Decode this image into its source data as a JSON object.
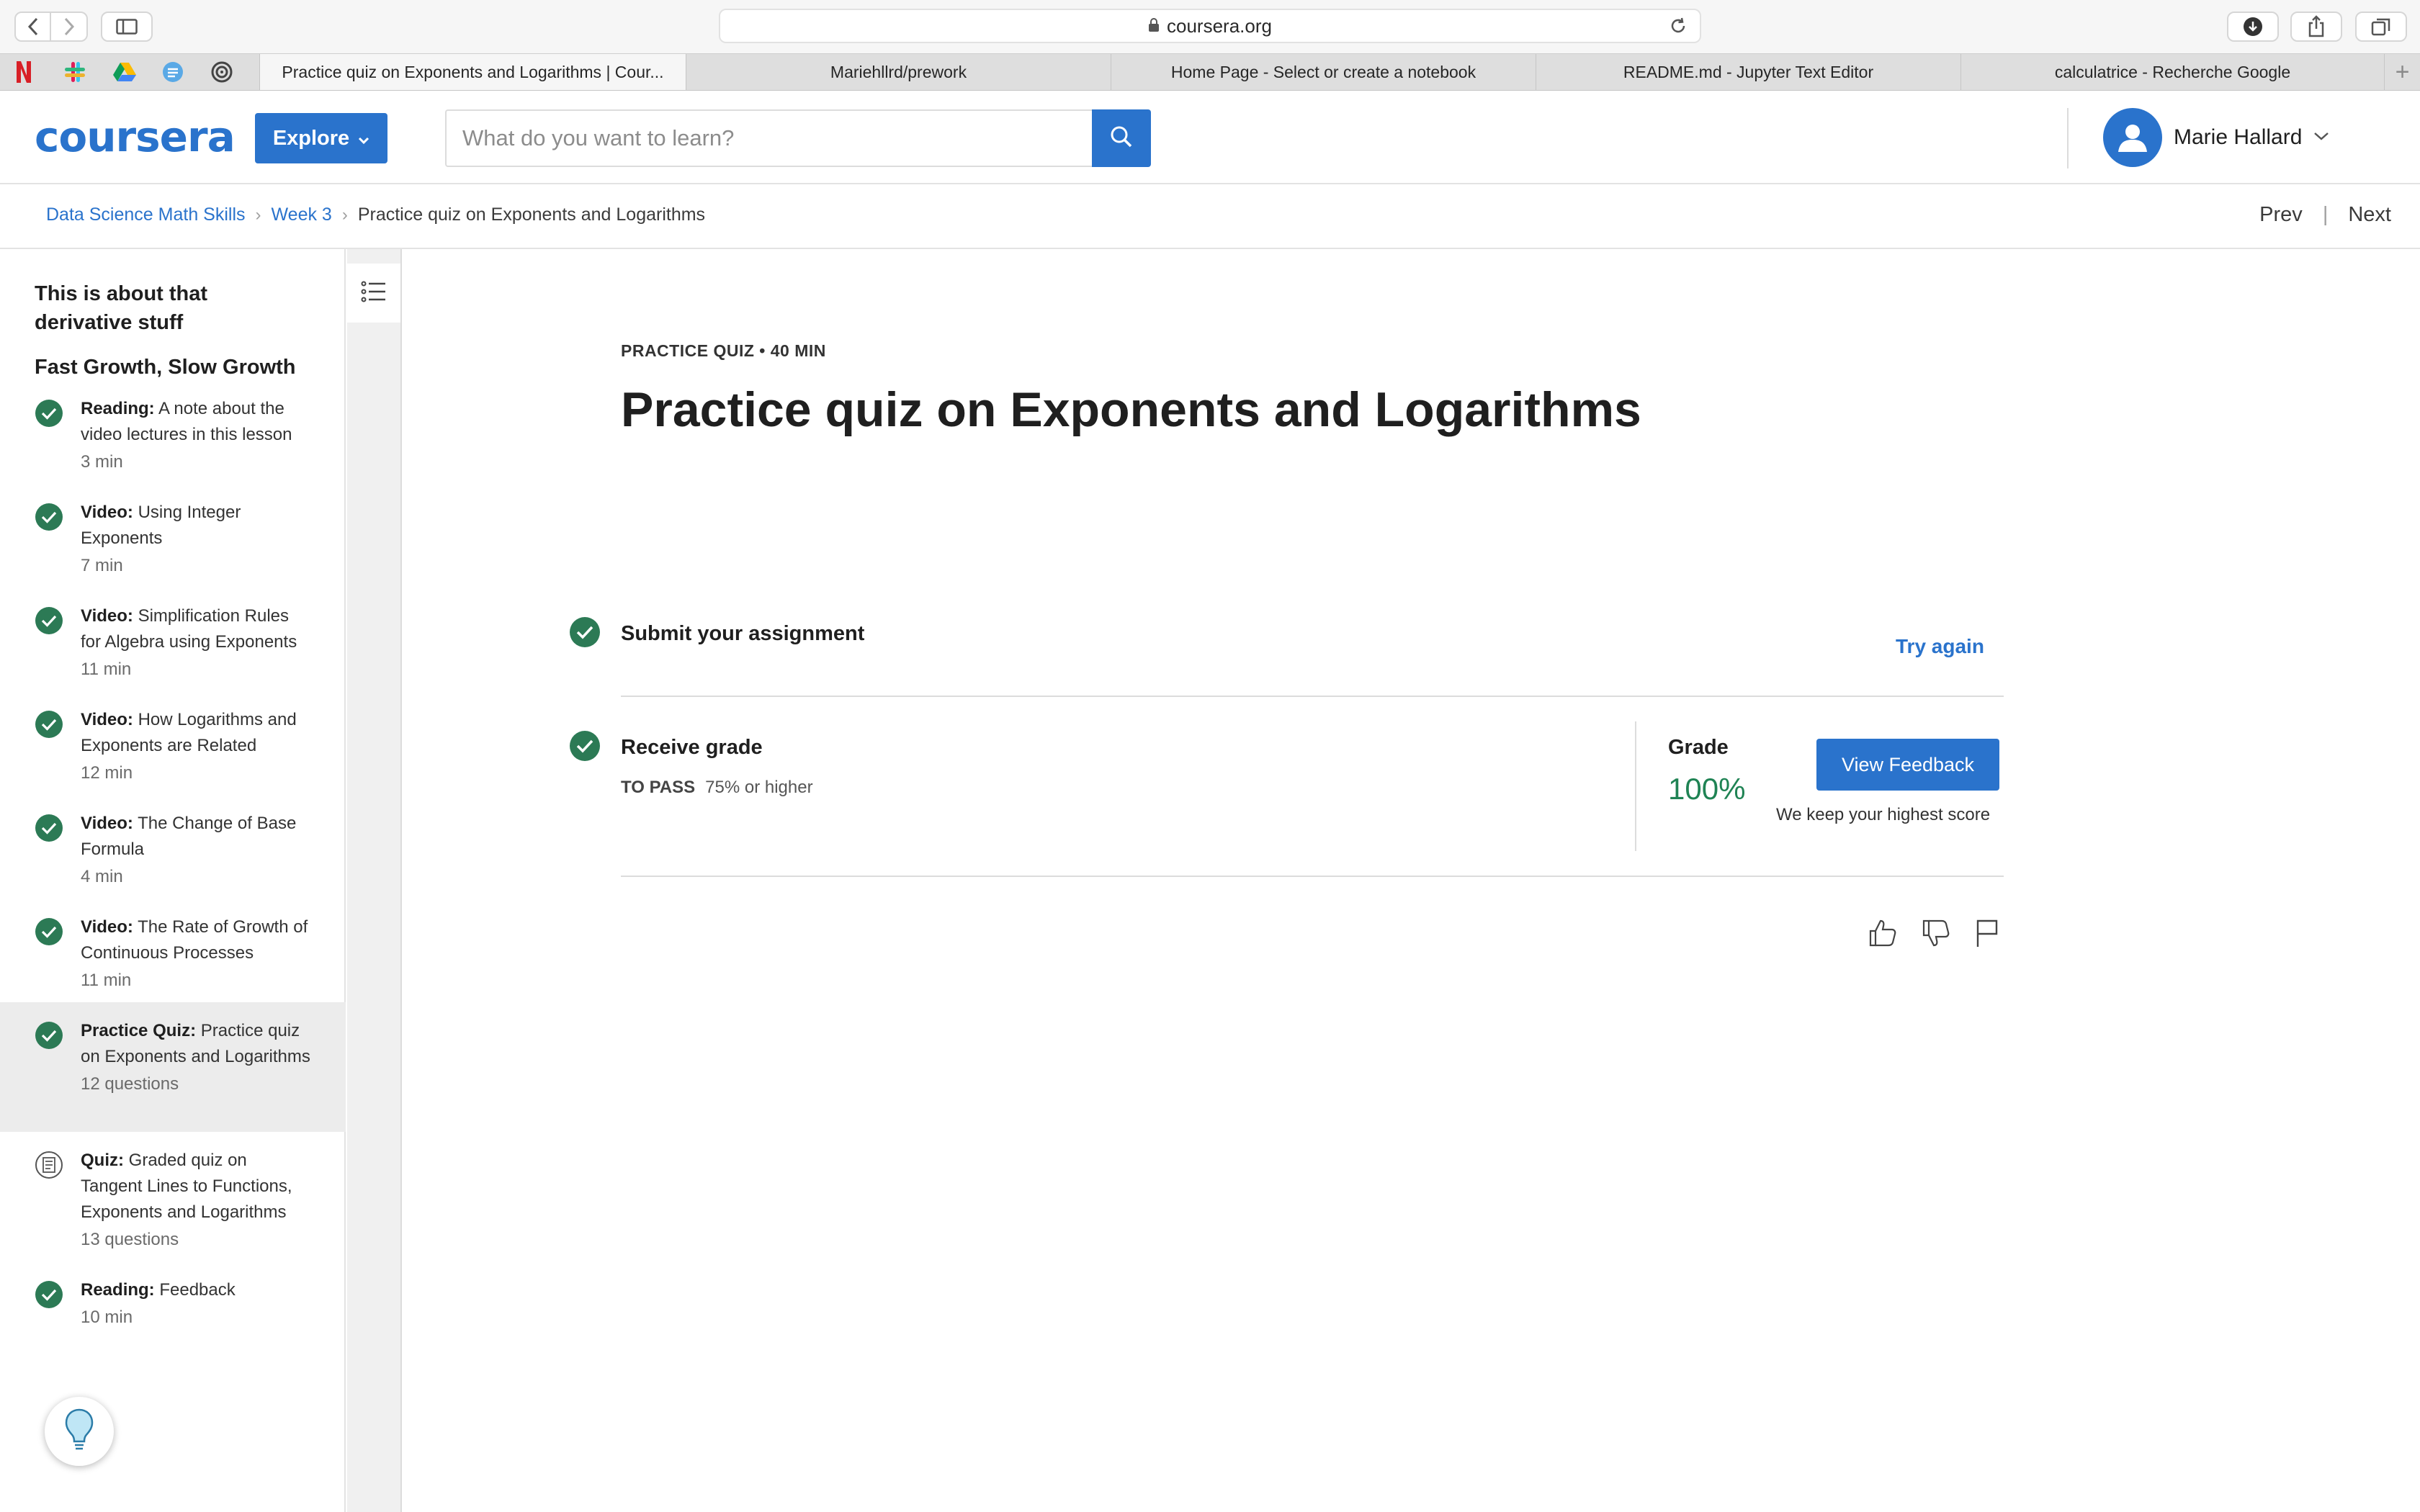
{
  "browser": {
    "url": "coursera.org",
    "tabs": [
      {
        "label": "Practice quiz on Exponents and Logarithms | Cour...",
        "active": true
      },
      {
        "label": "Mariehllrd/prework",
        "active": false
      },
      {
        "label": "Home Page - Select or create a notebook",
        "active": false
      },
      {
        "label": "README.md - Jupyter Text Editor",
        "active": false
      },
      {
        "label": "calculatrice - Recherche Google",
        "active": false
      }
    ],
    "favorites": [
      "netflix-icon",
      "slack-icon",
      "google-drive-icon",
      "shield-app-icon",
      "spiral-app-icon"
    ]
  },
  "header": {
    "logo": "coursera",
    "explore_label": "Explore",
    "search_placeholder": "What do you want to learn?",
    "user_name": "Marie Hallard"
  },
  "breadcrumb": {
    "items": [
      "Data Science Math Skills",
      "Week 3"
    ],
    "current": "Practice quiz on Exponents and Logarithms",
    "prev": "Prev",
    "next": "Next"
  },
  "sidebar": {
    "module_title": "This is about that derivative stuff",
    "lesson_title": "Fast Growth, Slow Growth",
    "items": [
      {
        "type": "Reading:",
        "title": "A note about the video lectures in this lesson",
        "meta": "3 min",
        "status": "complete"
      },
      {
        "type": "Video:",
        "title": "Using Integer Exponents",
        "meta": "7 min",
        "status": "complete"
      },
      {
        "type": "Video:",
        "title": "Simplification Rules for Algebra using Exponents",
        "meta": "11 min",
        "status": "complete"
      },
      {
        "type": "Video:",
        "title": "How Logarithms and Exponents are Related",
        "meta": "12 min",
        "status": "complete"
      },
      {
        "type": "Video:",
        "title": "The Change of Base Formula",
        "meta": "4 min",
        "status": "complete"
      },
      {
        "type": "Video:",
        "title": "The Rate of Growth of Continuous Processes",
        "meta": "11 min",
        "status": "complete"
      },
      {
        "type": "Practice Quiz:",
        "title": "Practice quiz on Exponents and Logarithms",
        "meta": "12 questions",
        "status": "complete"
      },
      {
        "type": "Quiz:",
        "title": "Graded quiz on Tangent Lines to Functions, Exponents and Logarithms",
        "meta": "13 questions",
        "status": "quiz"
      },
      {
        "type": "Reading:",
        "title": "Feedback",
        "meta": "10 min",
        "status": "complete"
      }
    ]
  },
  "main": {
    "eyebrow": "PRACTICE QUIZ • 40 MIN",
    "title": "Practice quiz on Exponents and Logarithms",
    "submit_label": "Submit your assignment",
    "try_again": "Try again",
    "receive_label": "Receive grade",
    "to_pass_label": "TO PASS",
    "to_pass_value": "75% or higher",
    "grade_label": "Grade",
    "grade_value": "100%",
    "view_feedback": "View Feedback",
    "keep_note": "We keep your highest score"
  },
  "colors": {
    "brand": "#2a73cc",
    "success": "#1f8354",
    "check": "#2c7a55"
  }
}
